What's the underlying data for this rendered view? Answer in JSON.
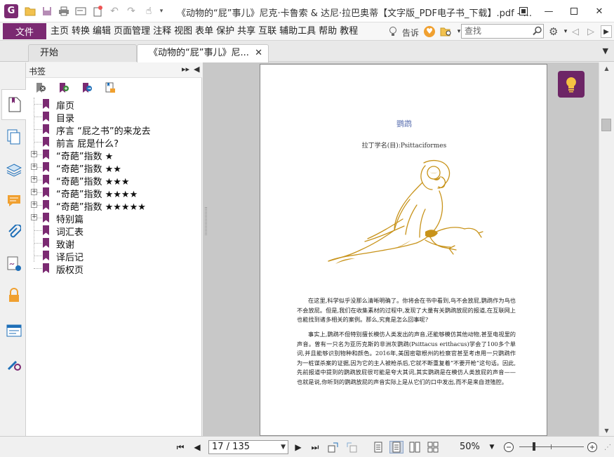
{
  "window": {
    "title": "《动物的“屁”事儿》尼克·卡鲁索 & 达尼·拉巴奥蒂【文字版_PDF电子书_下载】.pdf - ...",
    "logo_letter": "G"
  },
  "menu": {
    "file": "文件",
    "items": [
      "主页",
      "转换",
      "编辑",
      "页面管理",
      "注释",
      "视图",
      "表单",
      "保护",
      "共享",
      "互联",
      "辅助工具",
      "帮助",
      "教程"
    ],
    "tell_me": "告诉",
    "search_placeholder": "查找"
  },
  "tabs": [
    {
      "label": "开始"
    },
    {
      "label": "《动物的“屁”事儿》尼..."
    }
  ],
  "bookmarks": {
    "title": "书签",
    "items": [
      {
        "label": "扉页",
        "expandable": false
      },
      {
        "label": "目录",
        "expandable": false
      },
      {
        "label": "序言 “屁之书”的来龙去",
        "expandable": false
      },
      {
        "label": "前言 屁是什么?",
        "expandable": false
      },
      {
        "label": "“奇葩”指数 ★",
        "expandable": true
      },
      {
        "label": "“奇葩”指数 ★★",
        "expandable": true
      },
      {
        "label": "“奇葩”指数 ★★★",
        "expandable": true
      },
      {
        "label": "“奇葩”指数 ★★★★",
        "expandable": true
      },
      {
        "label": "“奇葩”指数 ★★★★★",
        "expandable": true
      },
      {
        "label": "特别篇",
        "expandable": true
      },
      {
        "label": "词汇表",
        "expandable": false
      },
      {
        "label": "致谢",
        "expandable": false
      },
      {
        "label": "译后记",
        "expandable": false
      },
      {
        "label": "版权页",
        "expandable": false
      }
    ]
  },
  "document": {
    "heading": "鹦鹉",
    "latin": "拉丁学名(目):Psittaciformes",
    "paragraph1": "在这里,科学似乎没那么清晰明确了。你将会在书中看到,鸟不会放屁,鹦鹉作为鸟也不会放屁。但是,我们在收集素材的过程中,发现了大量有关鹦鹉放屁的报道,在互联网上也能找到诸多相关的案例。那么,究竟是怎么回事呢?",
    "paragraph2": "事实上,鹦鹉不但特别擅长模仿人类发出的声音,还能够模仿其他动物,甚至电视里的声音。曾有一只名为亚历克斯的非洲灰鹦鹉(Psittacus erithacus)学会了100多个单词,并且能够识别物种和颜色。2016年,美国密歇根州的检察官甚至考虑用一只鹦鹉作为一桩谋杀案的证据,因为它的主人被枪杀后,它就不断重复着“不要开枪”这句话。因此,先前报道中提到的鹦鹉放屁很可能是夸大其词,其实鹦鹉是在模仿人类放屁的声音——也就是说,你听到的鹦鹉放屁的声音实际上是从它们的口中发出,而不是来自泄殖腔。",
    "illustration_color": "#c8931a"
  },
  "status": {
    "page_display": "17 / 135",
    "zoom": "50%",
    "zoom_level": 0.22
  },
  "colors": {
    "brand": "#7b2a72",
    "doc_heading": "#5a6fb0"
  }
}
